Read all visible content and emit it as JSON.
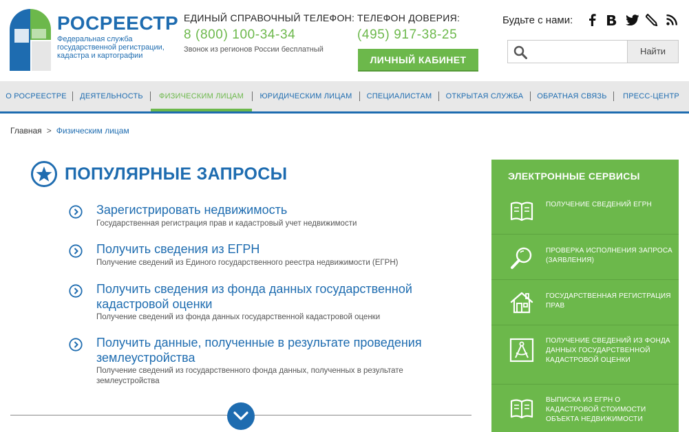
{
  "brand": {
    "name": "РОСРЕЕСТР",
    "subtitle": "Федеральная служба государственной регистрации, кадастра и картографии"
  },
  "contacts": {
    "main_label": "ЕДИНЫЙ СПРАВОЧНЫЙ ТЕЛЕФОН:",
    "main_phone": "8 (800) 100-34-34",
    "main_note": "Звонок из регионов России бесплатный",
    "trust_label": "ТЕЛЕФОН ДОВЕРИЯ:",
    "trust_phone": "(495) 917-38-25"
  },
  "cabinet_label": "ЛИЧНЫЙ КАБИНЕТ",
  "social": {
    "label": "Будьте с нами:",
    "icons": [
      "facebook-icon",
      "vk-icon",
      "twitter-icon",
      "livejournal-icon",
      "rss-icon"
    ]
  },
  "search": {
    "placeholder": "",
    "button": "Найти"
  },
  "nav": {
    "items": [
      {
        "label": "О РОСРЕЕСТРЕ",
        "active": false
      },
      {
        "label": "ДЕЯТЕЛЬНОСТЬ",
        "active": false
      },
      {
        "label": "ФИЗИЧЕСКИМ ЛИЦАМ",
        "active": true
      },
      {
        "label": "ЮРИДИЧЕСКИМ ЛИЦАМ",
        "active": false
      },
      {
        "label": "СПЕЦИАЛИСТАМ",
        "active": false
      },
      {
        "label": "ОТКРЫТАЯ СЛУЖБА",
        "active": false
      },
      {
        "label": "ОБРАТНАЯ СВЯЗЬ",
        "active": false
      },
      {
        "label": "ПРЕСС-ЦЕНТР",
        "active": false
      }
    ]
  },
  "breadcrumb": {
    "home": "Главная",
    "separator": ">",
    "current": "Физическим лицам"
  },
  "popular": {
    "title": "ПОПУЛЯРНЫЕ ЗАПРОСЫ",
    "items": [
      {
        "title": "Зарегистрировать недвижимость",
        "desc": "Государственная регистрация прав и кадастровый учет недвижимости"
      },
      {
        "title": "Получить сведения из ЕГРН",
        "desc": "Получение сведений из Единого государственного реестра недвижимости (ЕГРН)"
      },
      {
        "title": "Получить сведения из фонда данных государственной кадастровой оценки",
        "desc": "Получение сведений из фонда данных государственной кадастровой оценки"
      },
      {
        "title": "Получить данные, полученные в результате проведения землеустройства",
        "desc": "Получение сведений из государственного фонда данных, полученных в результате землеустройства"
      }
    ]
  },
  "services": {
    "title": "ЭЛЕКТРОННЫЕ СЕРВИСЫ",
    "items": [
      {
        "label": "ПОЛУЧЕНИЕ СВЕДЕНИЙ ЕГРН",
        "icon": "book-icon"
      },
      {
        "label": "ПРОВЕРКА ИСПОЛНЕНИЯ ЗАПРОСА (ЗАЯВЛЕНИЯ)",
        "icon": "magnifier-icon"
      },
      {
        "label": "ГОСУДАРСТВЕННАЯ РЕГИСТРАЦИЯ ПРАВ",
        "icon": "house-icon"
      },
      {
        "label": "ПОЛУЧЕНИЕ СВЕДЕНИЙ ИЗ ФОНДА ДАННЫХ ГОСУДАРСТВЕННОЙ КАДАСТРОВОЙ ОЦЕНКИ",
        "icon": "compass-icon"
      },
      {
        "label": "ВЫПИСКА ИЗ ЕГРН О КАДАСТРОВОЙ СТОИМОСТИ ОБЪЕКТА НЕДВИЖИМОСТИ",
        "icon": "book-icon"
      }
    ]
  },
  "colors": {
    "brand_blue": "#1e6cb0",
    "accent_green": "#6cb84b",
    "nav_bg": "#e8e8e8"
  }
}
